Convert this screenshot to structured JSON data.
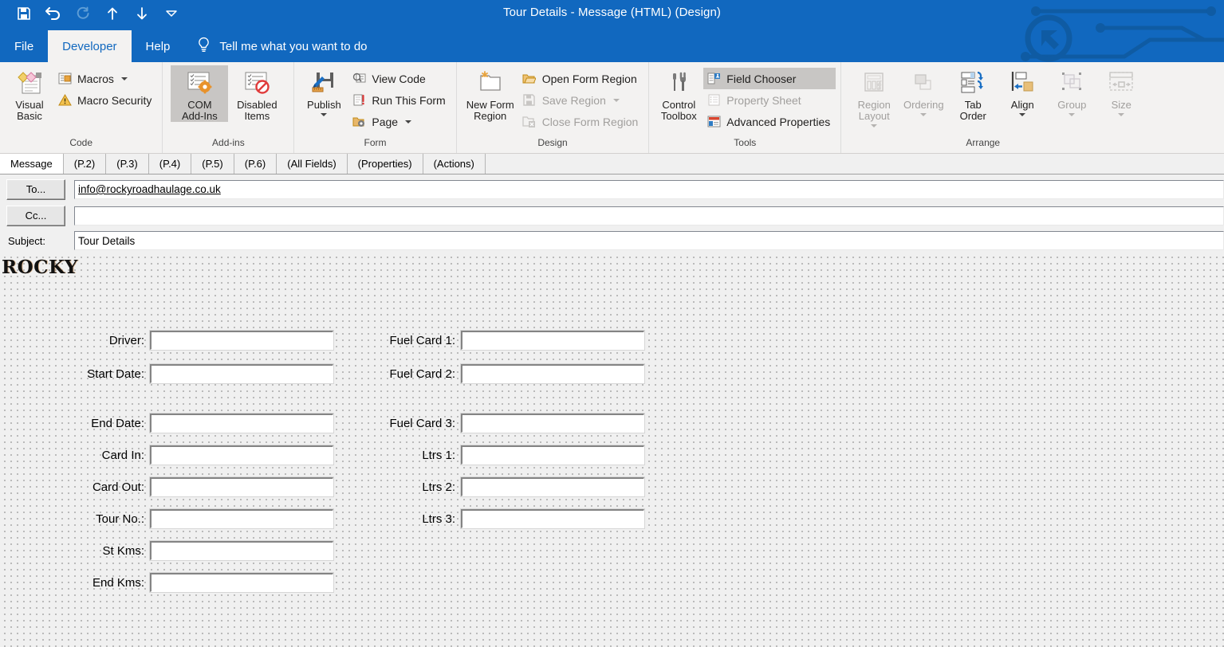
{
  "window": {
    "title": "Tour Details  -  Message (HTML)  (Design)",
    "accent_color": "#1168bf",
    "ribbon_bg": "#f3f2f1"
  },
  "quick_access": [
    {
      "name": "save-icon",
      "label": "Save",
      "enabled": true
    },
    {
      "name": "undo-icon",
      "label": "Undo",
      "enabled": true
    },
    {
      "name": "redo-icon",
      "label": "Redo",
      "enabled": false
    },
    {
      "name": "previous-item-icon",
      "label": "Previous Item",
      "enabled": true
    },
    {
      "name": "next-item-icon",
      "label": "Next Item",
      "enabled": true
    },
    {
      "name": "customize-toolbar-icon",
      "label": "Customize Quick Access Toolbar",
      "enabled": true
    }
  ],
  "menu": {
    "tabs": [
      {
        "label": "File",
        "active": false
      },
      {
        "label": "Developer",
        "active": true
      },
      {
        "label": "Help",
        "active": false
      }
    ],
    "tell_me": "Tell me what you want to do"
  },
  "ribbon": {
    "groups": [
      {
        "label": "Code",
        "big": [
          {
            "label_line1": "Visual",
            "label_line2": "Basic",
            "icon": "visual-basic-icon",
            "enabled": true
          }
        ],
        "small": [
          {
            "label": "Macros",
            "icon": "macros-icon",
            "enabled": true,
            "caret": true
          },
          {
            "label": "Macro Security",
            "icon": "macro-security-icon",
            "enabled": true,
            "caret": false
          }
        ]
      },
      {
        "label": "Add-ins",
        "big": [
          {
            "label_line1": "COM",
            "label_line2": "Add-Ins",
            "icon": "com-addins-icon",
            "enabled": true,
            "selected": true
          },
          {
            "label_line1": "Disabled",
            "label_line2": "Items",
            "icon": "disabled-items-icon",
            "enabled": true,
            "selected": false
          }
        ],
        "small": []
      },
      {
        "label": "Form",
        "big": [
          {
            "label_line1": "Publish",
            "label_line2": "",
            "icon": "publish-icon",
            "enabled": true,
            "caret": true
          }
        ],
        "small": [
          {
            "label": "View Code",
            "icon": "view-code-icon",
            "enabled": true,
            "caret": false
          },
          {
            "label": "Run This Form",
            "icon": "run-this-form-icon",
            "enabled": true,
            "caret": false
          },
          {
            "label": "Page",
            "icon": "page-icon",
            "enabled": true,
            "caret": true
          }
        ]
      },
      {
        "label": "Design",
        "big": [
          {
            "label_line1": "New Form",
            "label_line2": "Region",
            "icon": "new-form-region-icon",
            "enabled": true
          }
        ],
        "small": [
          {
            "label": "Open Form Region",
            "icon": "open-form-region-icon",
            "enabled": true,
            "caret": false
          },
          {
            "label": "Save Region",
            "icon": "save-region-icon",
            "enabled": false,
            "caret": true
          },
          {
            "label": "Close Form Region",
            "icon": "close-form-region-icon",
            "enabled": false,
            "caret": false
          }
        ]
      },
      {
        "label": "Tools",
        "big": [
          {
            "label_line1": "Control",
            "label_line2": "Toolbox",
            "icon": "control-toolbox-icon",
            "enabled": true
          }
        ],
        "small": [
          {
            "label": "Field Chooser",
            "icon": "field-chooser-icon",
            "enabled": true,
            "selected": true,
            "caret": false
          },
          {
            "label": "Property Sheet",
            "icon": "property-sheet-icon",
            "enabled": false,
            "caret": false
          },
          {
            "label": "Advanced Properties",
            "icon": "advanced-properties-icon",
            "enabled": true,
            "caret": false
          }
        ]
      },
      {
        "label": "Arrange",
        "big": [
          {
            "label_line1": "Region",
            "label_line2": "Layout",
            "icon": "region-layout-icon",
            "enabled": false,
            "caret": true
          },
          {
            "label_line1": "Ordering",
            "label_line2": "",
            "icon": "ordering-icon",
            "enabled": false,
            "caret": true
          },
          {
            "label_line1": "Tab",
            "label_line2": "Order",
            "icon": "tab-order-icon",
            "enabled": true,
            "caret": false
          },
          {
            "label_line1": "Align",
            "label_line2": "",
            "icon": "align-icon",
            "enabled": true,
            "caret": true
          },
          {
            "label_line1": "Group",
            "label_line2": "",
            "icon": "group-icon",
            "enabled": false,
            "caret": true
          },
          {
            "label_line1": "Size",
            "label_line2": "",
            "icon": "size-icon",
            "enabled": false,
            "caret": true
          }
        ],
        "small": []
      }
    ]
  },
  "page_tabs": [
    {
      "label": "Message",
      "active": true
    },
    {
      "label": "(P.2)",
      "active": false
    },
    {
      "label": "(P.3)",
      "active": false
    },
    {
      "label": "(P.4)",
      "active": false
    },
    {
      "label": "(P.5)",
      "active": false
    },
    {
      "label": "(P.6)",
      "active": false
    },
    {
      "label": "(All Fields)",
      "active": false
    },
    {
      "label": "(Properties)",
      "active": false
    },
    {
      "label": "(Actions)",
      "active": false
    }
  ],
  "header": {
    "to_button": "To...",
    "to_value": "info@rockyroadhaulage.co.uk",
    "cc_button": "Cc...",
    "cc_value": "",
    "subject_label": "Subject:",
    "subject_value": "Tour Details"
  },
  "form": {
    "logo_text": "ROCKY",
    "fields_left": [
      {
        "label": "Driver:",
        "value": ""
      },
      {
        "label": "Start Date:",
        "value": ""
      },
      {
        "label": "End Date:",
        "value": ""
      },
      {
        "label": "Card In:",
        "value": ""
      },
      {
        "label": "Card Out:",
        "value": ""
      },
      {
        "label": "Tour No.:",
        "value": ""
      },
      {
        "label": "St Kms:",
        "value": ""
      },
      {
        "label": "End Kms:",
        "value": ""
      }
    ],
    "fields_right": [
      {
        "label": "Fuel Card 1:",
        "value": ""
      },
      {
        "label": "Fuel Card 2:",
        "value": ""
      },
      {
        "label": "Fuel Card 3:",
        "value": ""
      },
      {
        "label": "Ltrs 1:",
        "value": ""
      },
      {
        "label": "Ltrs 2:",
        "value": ""
      },
      {
        "label": "Ltrs 3:",
        "value": ""
      }
    ]
  }
}
